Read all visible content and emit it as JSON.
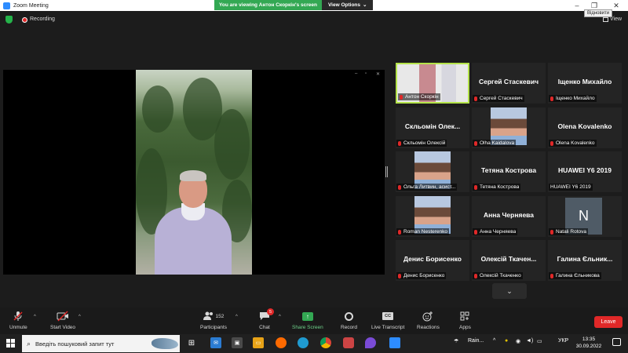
{
  "window": {
    "title": "Zoom Meeting",
    "tooltip": "Відновити"
  },
  "banner": {
    "message": "You are viewing Антон Скоркін's screen",
    "options_label": "View Options",
    "chevron": "⌄"
  },
  "meeting": {
    "recording_label": "Recording",
    "view_label": "View"
  },
  "gallery": [
    {
      "name": "Антон Скоркін",
      "big": "",
      "photo": true,
      "active": true
    },
    {
      "name": "Сергей Стаскевич",
      "big": "Сергей Стаскевич"
    },
    {
      "name": "Іщенко Михайло",
      "big": "Іщенко Михайло"
    },
    {
      "name": "Скльомін Олексій",
      "big": "Скльомін  Олек..."
    },
    {
      "name": "Olha Kaidalova",
      "big": "",
      "photo": true
    },
    {
      "name": "Olena Kovalenko",
      "big": "Olena Kovalenko"
    },
    {
      "name": "Ольга Литвин, асист...",
      "big": "",
      "photo": true
    },
    {
      "name": "Тетяна Кострова",
      "big": "Тетяна Кострова"
    },
    {
      "name": "HUAWEI Y6 2019",
      "big": "HUAWEI Y6 2019",
      "muted": false
    },
    {
      "name": "Roman Nesterenko",
      "big": "",
      "photo": true
    },
    {
      "name": "Анна Черняева",
      "big": "Анна Черняева"
    },
    {
      "name": "Natali Rotova",
      "big": "",
      "avatar": "N"
    },
    {
      "name": "Денис Борисенко",
      "big": "Денис Борисенко"
    },
    {
      "name": "Олексій Ткаченко",
      "big": "Олексій  Ткачен..."
    },
    {
      "name": "Галина Єльникова",
      "big": "Галина  Єльник..."
    }
  ],
  "toolbar": {
    "unmute": "Unmute",
    "start_video": "Start Video",
    "participants": "Participants",
    "participants_count": "152",
    "chat": "Chat",
    "chat_badge": "5",
    "share_screen": "Share Screen",
    "record": "Record",
    "live_transcript": "Live Transcript",
    "cc": "CC",
    "reactions": "Reactions",
    "apps": "Apps",
    "leave": "Leave"
  },
  "taskbar": {
    "search_placeholder": "Введіть пошуковий запит тут",
    "weather": "Rain...",
    "language": "УКР",
    "time": "13:35",
    "date": "30.09.2022"
  },
  "colors": {
    "accent_green": "#33a853",
    "leave_red": "#e02828",
    "active_border": "#b4e34a"
  }
}
